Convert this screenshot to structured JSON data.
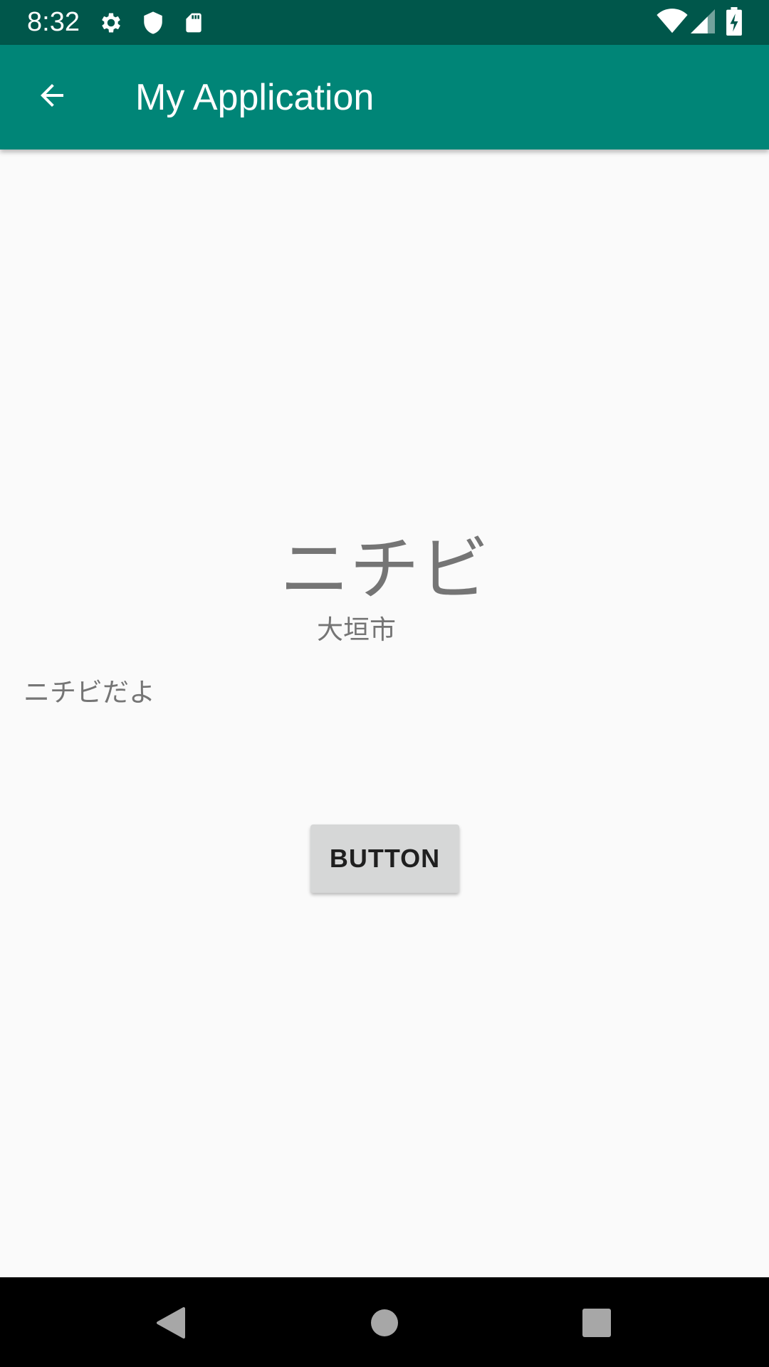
{
  "status_bar": {
    "time": "8:32",
    "left_icons": [
      "gear-icon",
      "shield-icon",
      "sd-card-icon"
    ],
    "right_icons": [
      "wifi-icon",
      "cellular-signal-icon",
      "battery-charging-icon"
    ]
  },
  "app_bar": {
    "back_icon": "arrow-back-icon",
    "title": "My Application",
    "color": "#008577",
    "status_color": "#00574b"
  },
  "main": {
    "title": "ニチビ",
    "subtitle": "大垣市",
    "body_text": "ニチビだよ",
    "button_label": "BUTTON"
  },
  "nav_bar": {
    "items": [
      "back-triangle-icon",
      "home-circle-icon",
      "recents-square-icon"
    ]
  }
}
